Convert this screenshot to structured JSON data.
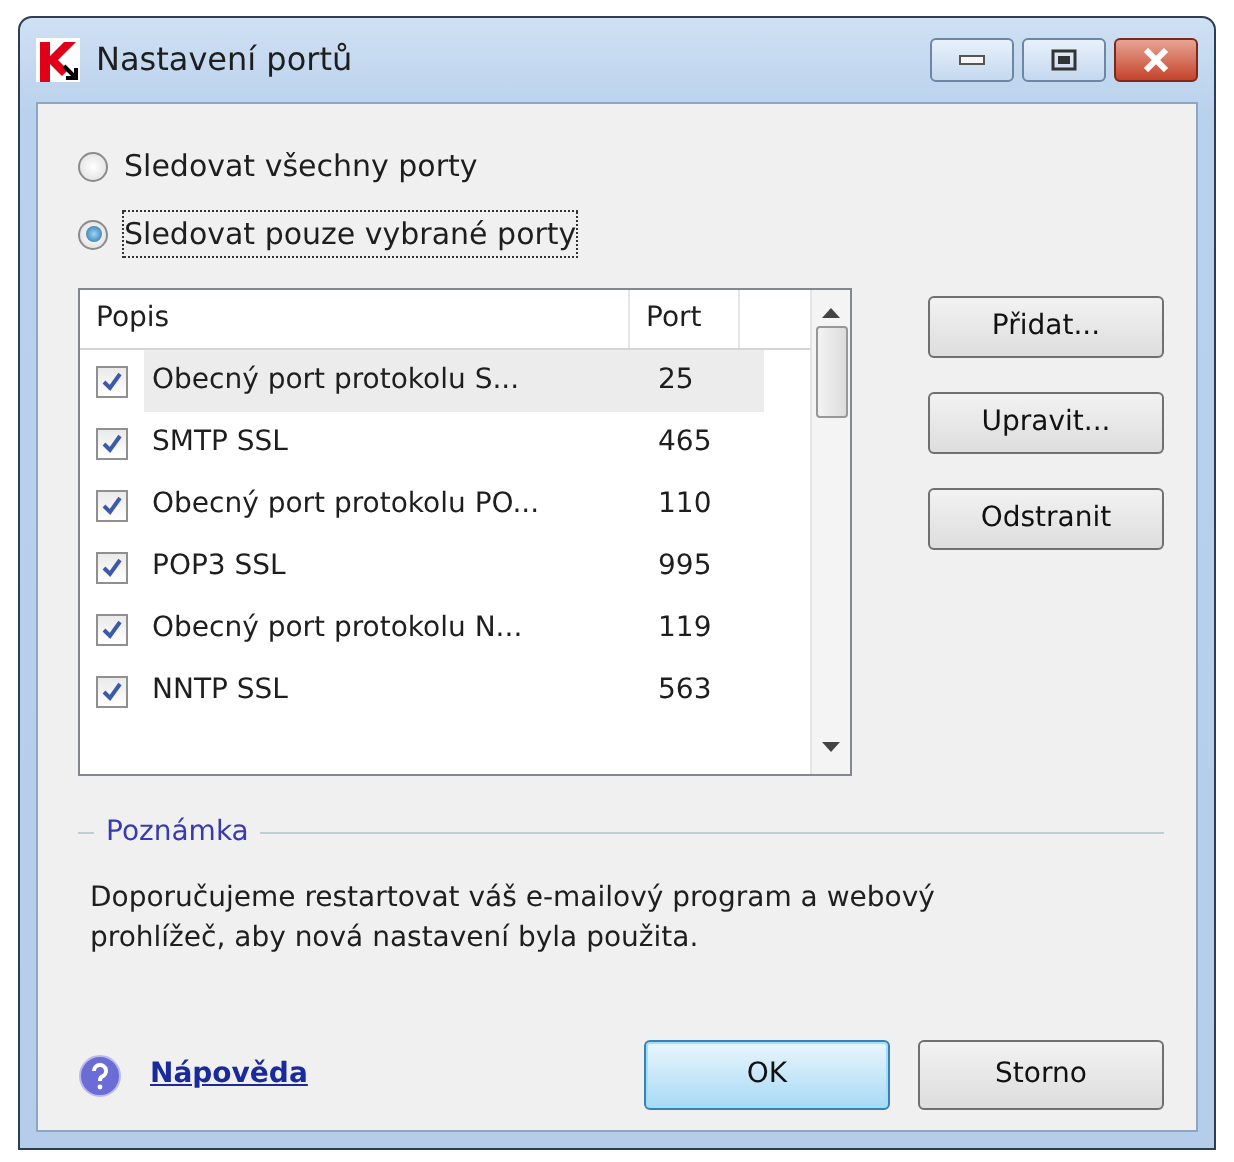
{
  "window": {
    "title": "Nastavení portů"
  },
  "modes": [
    {
      "label": "Sledovat všechny porty",
      "selected": false
    },
    {
      "label": "Sledovat pouze vybrané porty",
      "selected": true
    }
  ],
  "table": {
    "columns": [
      "Popis",
      "Port"
    ],
    "rows": [
      {
        "name": "Obecný port protokolu S...",
        "port": "25",
        "checked": true,
        "selected": true
      },
      {
        "name": "SMTP SSL",
        "port": "465",
        "checked": true,
        "selected": false
      },
      {
        "name": "Obecný port protokolu PO...",
        "port": "110",
        "checked": true,
        "selected": false
      },
      {
        "name": "POP3 SSL",
        "port": "995",
        "checked": true,
        "selected": false
      },
      {
        "name": "Obecný port protokolu N...",
        "port": "119",
        "checked": true,
        "selected": false
      },
      {
        "name": "NNTP SSL",
        "port": "563",
        "checked": true,
        "selected": false
      }
    ]
  },
  "side_buttons": [
    "Přidat...",
    "Upravit...",
    "Odstranit"
  ],
  "note": {
    "title": "Poznámka",
    "text": "Doporučujeme restartovat váš e-mailový program a webový prohlížeč, aby nová nastavení byla použita."
  },
  "help_link": "Nápověda",
  "buttons": [
    {
      "label": "OK",
      "default": true
    },
    {
      "label": "Storno",
      "default": false
    }
  ]
}
